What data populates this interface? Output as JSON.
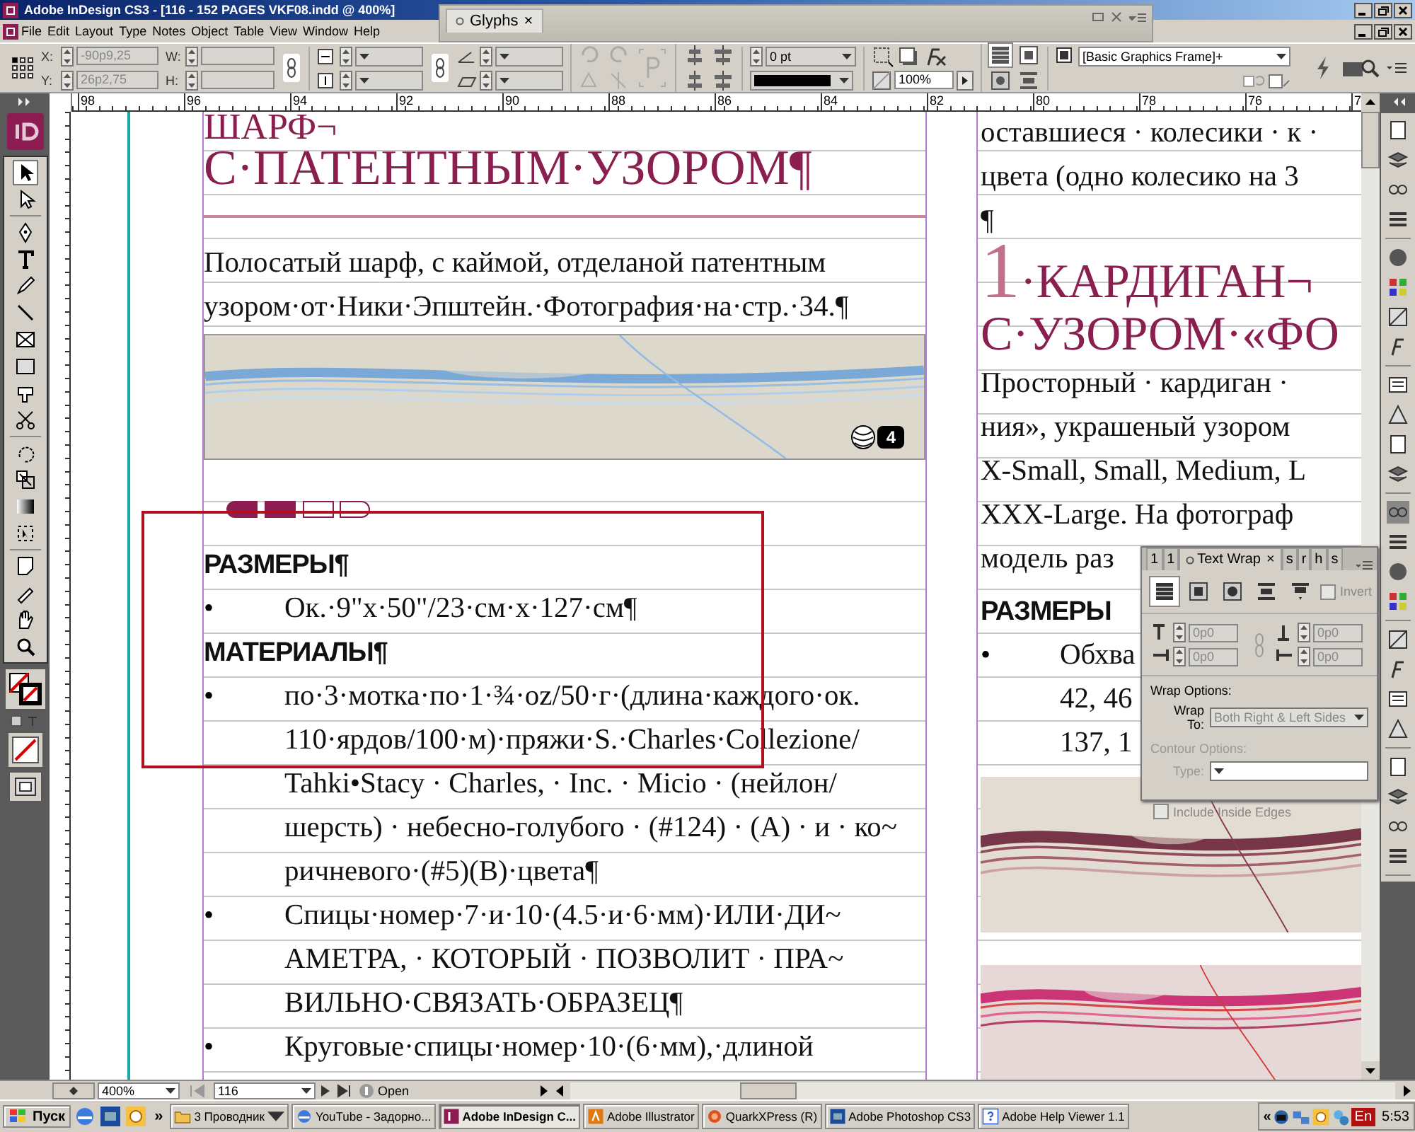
{
  "window": {
    "title": "Adobe InDesign CS3 - [116 - 152 PAGES VKF08.indd @ 400%]"
  },
  "menu": [
    "File",
    "Edit",
    "Layout",
    "Type",
    "Notes",
    "Object",
    "Table",
    "View",
    "Window",
    "Help"
  ],
  "glyphs_panel": {
    "tab": "Glyphs",
    "close": "×"
  },
  "control_panel": {
    "x_label": "X:",
    "x": "-90p9,25",
    "y_label": "Y:",
    "y": "26p2,75",
    "w_label": "W:",
    "h_label": "H:",
    "stroke_weight": "0 pt",
    "opacity": "100%",
    "object_style": "[Basic Graphics Frame]+"
  },
  "ruler": [
    "98",
    "96",
    "94",
    "92",
    "90",
    "88",
    "86",
    "84",
    "82",
    "80",
    "78",
    "76",
    "7"
  ],
  "left_column": {
    "heading_cut": "ШАРФ¬",
    "heading": "С·ПАТЕНТНЫМ·УЗОРОМ¶",
    "intro": [
      "Полосатый шарф, с каймой, отделаной патентным",
      "узором·от·Ники·Эпштейн.·Фотография·на·стр.·34.¶"
    ],
    "photo_badge": "4",
    "blocks": [
      {
        "kind": "heading",
        "text": "РАЗМЕРЫ¶"
      },
      {
        "kind": "bullet",
        "bullet": "•",
        "lines": [
          "Ок.·9\"x·50\"/23·см·x·127·см¶"
        ]
      },
      {
        "kind": "heading",
        "text": "МАТЕРИАЛЫ¶"
      },
      {
        "kind": "bullet",
        "bullet": "•",
        "lines": [
          "по·3·мотка·по·1·¾·oz/50·г·(длина·каждого·ок.",
          "110·ярдов/100·м)·пряжи·S.·Charles·Collezione/",
          "Tahki•Stacy · Charles, · Inc. · Micio · (нейлон/",
          "шерсть) · небесно-голубого · (#124) · (A) · и · ко~",
          "ричневого·(#5)(B)·цвета¶"
        ]
      },
      {
        "kind": "bullet",
        "bullet": "•",
        "lines": [
          "Спицы·номер·7·и·10·(4.5·и·6·мм)·ИЛИ·ДИ~",
          "АМЕТРА, · КОТОРЫЙ · ПОЗВОЛИТ · ПРА~",
          "ВИЛЬНО·СВЯЗАТЬ·ОБРАЗЕЦ¶"
        ]
      },
      {
        "kind": "bullet",
        "bullet": "•",
        "lines": [
          "Круговые·спицы·номер·10·(6·мм),·длиной"
        ]
      }
    ]
  },
  "right_column": {
    "top_lines": [
      "оставшиеся · колесики · к ·",
      "цвета (одно колесико на 3",
      "¶"
    ],
    "heading_number": "1",
    "heading": "·КАРДИГАН¬",
    "heading_line2": "С·УЗОРОМ·«ФО",
    "intro": [
      "Просторный · кардиган ·",
      "ния», украшеный узором",
      "X-Small, Small, Medium, L",
      "XXX-Large. На фотограф",
      "модель раз"
    ],
    "sizes_heading": "РАЗМЕРЫ",
    "bullet": {
      "bullet": "•",
      "lines": [
        "Обхва",
        "42, 46",
        "137, 1"
      ]
    }
  },
  "text_wrap_panel": {
    "tabs": [
      {
        "label": "1",
        "selected": false
      },
      {
        "label": "1",
        "selected": false
      },
      {
        "label": "Text Wrap",
        "selected": true
      },
      {
        "label": "s",
        "selected": false
      },
      {
        "label": "r",
        "selected": false
      },
      {
        "label": "h",
        "selected": false
      },
      {
        "label": "s",
        "selected": false
      }
    ],
    "close": "×",
    "wrap_modes": [
      {
        "selected": true
      },
      {
        "selected": false
      },
      {
        "selected": false
      },
      {
        "selected": false
      },
      {
        "selected": false
      }
    ],
    "invert": {
      "label": "Invert",
      "checked": false
    },
    "offsets": [
      "0p0",
      "0p0",
      "0p0",
      "0p0"
    ],
    "wrap_options_label": "Wrap Options:",
    "wrap_to_label": "Wrap To:",
    "wrap_to": "Both Right & Left Sides",
    "contour_label": "Contour Options:",
    "type_label": "Type:",
    "include_inside_edges": {
      "label": "Include Inside Edges",
      "checked": false
    }
  },
  "status_bar": {
    "zoom": "400%",
    "page": "116",
    "status": "Open"
  },
  "taskbar": {
    "start": "Пуск",
    "more": "»",
    "items": [
      {
        "label": "3 Проводник",
        "selected": false
      },
      {
        "label": "YouTube - Задорно...",
        "selected": false
      },
      {
        "label": "Adobe InDesign C...",
        "selected": true
      },
      {
        "label": "Adobe Illustrator",
        "selected": false
      },
      {
        "label": "QuarkXPress (R)",
        "selected": false
      },
      {
        "label": "Adobe Photoshop CS3",
        "selected": false
      },
      {
        "label": "Adobe Help Viewer 1.1",
        "selected": false
      }
    ],
    "tray_expand": "«",
    "language": "En",
    "clock": "5:53"
  }
}
